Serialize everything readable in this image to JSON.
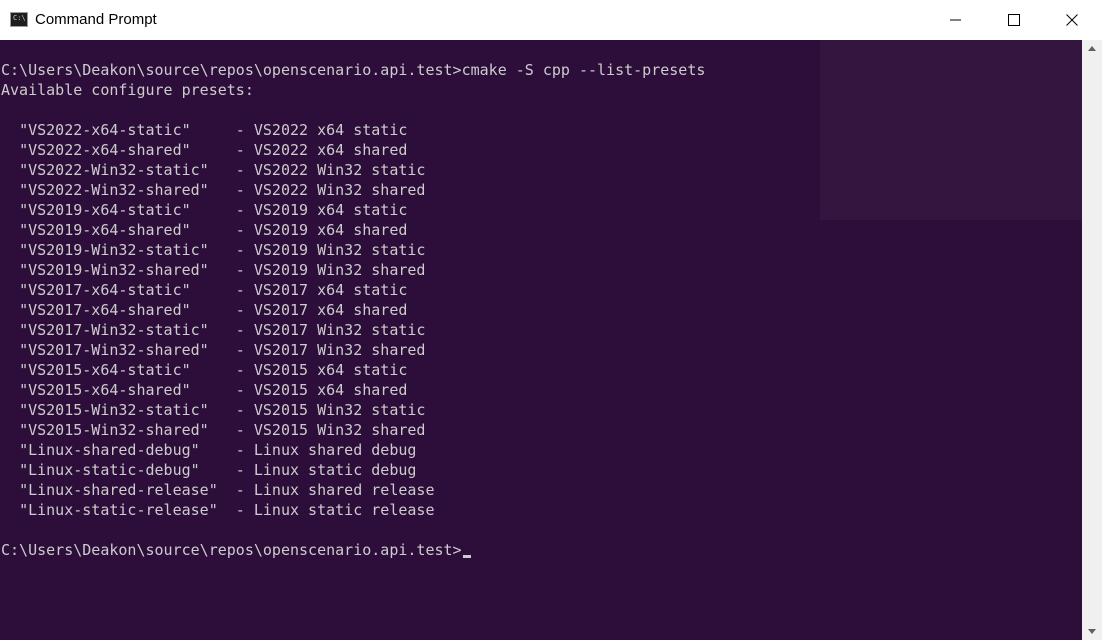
{
  "window": {
    "title": "Command Prompt",
    "icon": "console-icon",
    "icon_glyph": "C:\\",
    "controls": [
      "minimize-icon",
      "maximize-icon",
      "close-icon"
    ]
  },
  "console": {
    "background": "#2d0e3a",
    "text_color": "#cccccc",
    "command_line": "C:\\Users\\Deakon\\source\\repos\\openscenario.api.test>cmake -S cpp --list-presets",
    "header": "Available configure presets:",
    "presets": [
      {
        "name": "\"VS2022-x64-static\"",
        "pad": "    ",
        "desc": "VS2022 x64 static"
      },
      {
        "name": "\"VS2022-x64-shared\"",
        "pad": "    ",
        "desc": "VS2022 x64 shared"
      },
      {
        "name": "\"VS2022-Win32-static\"",
        "pad": "  ",
        "desc": "VS2022 Win32 static"
      },
      {
        "name": "\"VS2022-Win32-shared\"",
        "pad": "  ",
        "desc": "VS2022 Win32 shared"
      },
      {
        "name": "\"VS2019-x64-static\"",
        "pad": "    ",
        "desc": "VS2019 x64 static"
      },
      {
        "name": "\"VS2019-x64-shared\"",
        "pad": "    ",
        "desc": "VS2019 x64 shared"
      },
      {
        "name": "\"VS2019-Win32-static\"",
        "pad": "  ",
        "desc": "VS2019 Win32 static"
      },
      {
        "name": "\"VS2019-Win32-shared\"",
        "pad": "  ",
        "desc": "VS2019 Win32 shared"
      },
      {
        "name": "\"VS2017-x64-static\"",
        "pad": "    ",
        "desc": "VS2017 x64 static"
      },
      {
        "name": "\"VS2017-x64-shared\"",
        "pad": "    ",
        "desc": "VS2017 x64 shared"
      },
      {
        "name": "\"VS2017-Win32-static\"",
        "pad": "  ",
        "desc": "VS2017 Win32 static"
      },
      {
        "name": "\"VS2017-Win32-shared\"",
        "pad": "  ",
        "desc": "VS2017 Win32 shared"
      },
      {
        "name": "\"VS2015-x64-static\"",
        "pad": "    ",
        "desc": "VS2015 x64 static"
      },
      {
        "name": "\"VS2015-x64-shared\"",
        "pad": "    ",
        "desc": "VS2015 x64 shared"
      },
      {
        "name": "\"VS2015-Win32-static\"",
        "pad": "  ",
        "desc": "VS2015 Win32 static"
      },
      {
        "name": "\"VS2015-Win32-shared\"",
        "pad": "  ",
        "desc": "VS2015 Win32 shared"
      },
      {
        "name": "\"Linux-shared-debug\"",
        "pad": "   ",
        "desc": "Linux shared debug"
      },
      {
        "name": "\"Linux-static-debug\"",
        "pad": "   ",
        "desc": "Linux static debug"
      },
      {
        "name": "\"Linux-shared-release\"",
        "pad": " ",
        "desc": "Linux shared release"
      },
      {
        "name": "\"Linux-static-release\"",
        "pad": " ",
        "desc": "Linux static release"
      }
    ],
    "prompt": "C:\\Users\\Deakon\\source\\repos\\openscenario.api.test>"
  },
  "scrollbar": {
    "up": "scroll-up-arrow-icon",
    "down": "scroll-down-arrow-icon"
  }
}
